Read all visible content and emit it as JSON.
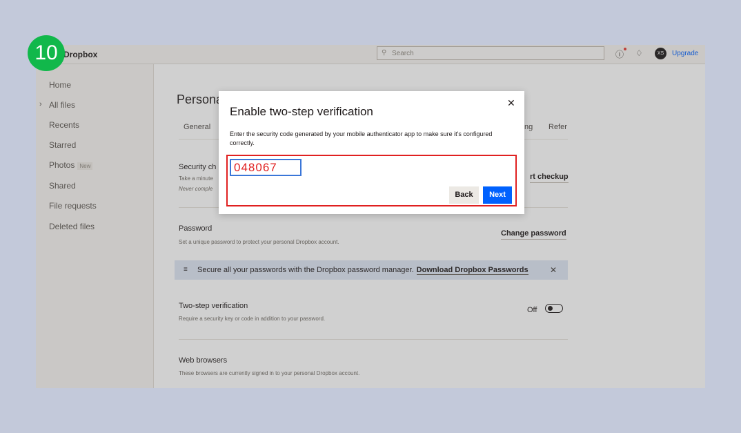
{
  "step_badge": "10",
  "app": {
    "logo": "Dropbox",
    "search_placeholder": "Search",
    "avatar_initials": "XS",
    "upgrade": "Upgrade"
  },
  "sidebar": {
    "items": [
      {
        "label": "Home"
      },
      {
        "label": "All files"
      },
      {
        "label": "Recents"
      },
      {
        "label": "Starred"
      },
      {
        "label": "Photos",
        "badge": "New"
      },
      {
        "label": "Shared"
      },
      {
        "label": "File requests"
      },
      {
        "label": "Deleted files"
      }
    ]
  },
  "main": {
    "title": "Personal",
    "tabs": [
      "General",
      "ng",
      "Refer"
    ],
    "security_checkup": {
      "title": "Security ch",
      "desc": "Take a minute",
      "desc2": "Never comple",
      "action": "rt checkup"
    },
    "password": {
      "title": "Password",
      "desc": "Set a unique password to protect your personal Dropbox account.",
      "action": "Change password"
    },
    "banner": {
      "text": "Secure all your passwords with the Dropbox password manager.",
      "link": "Download Dropbox Passwords"
    },
    "two_step": {
      "title": "Two-step verification",
      "desc": "Require a security key or code in addition to your password.",
      "status": "Off"
    },
    "web_browsers": {
      "title": "Web browsers",
      "desc": "These browsers are currently signed in to your personal Dropbox account."
    }
  },
  "modal": {
    "title": "Enable two-step verification",
    "description": "Enter the security code generated by your mobile authenticator app to make sure it's configured correctly.",
    "code_value": "048067",
    "back": "Back",
    "next": "Next"
  },
  "colors": {
    "accent": "#0061fe",
    "highlight": "#e02020",
    "badge": "#11b84b"
  }
}
